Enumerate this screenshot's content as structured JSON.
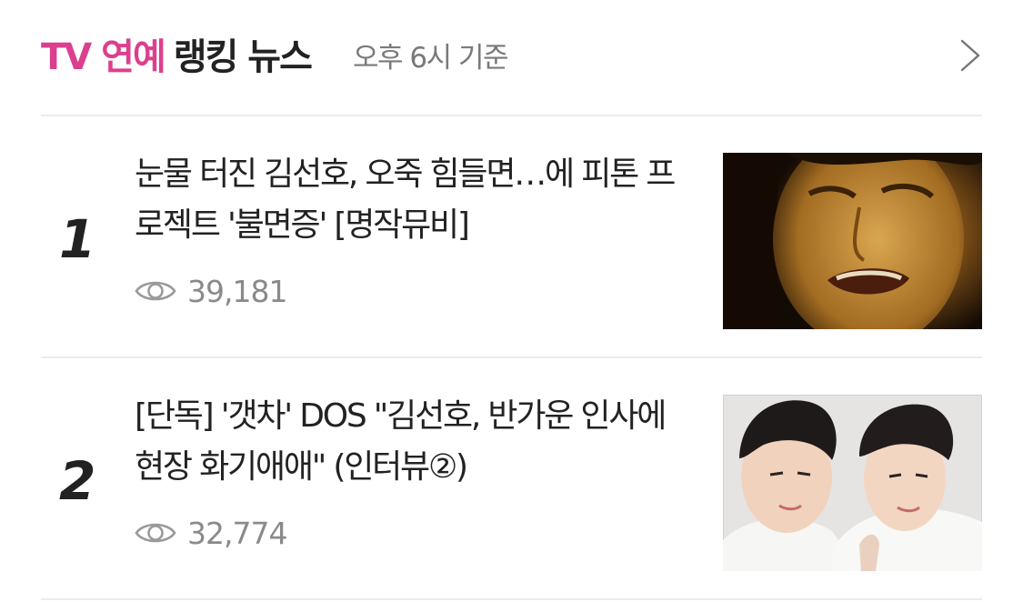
{
  "header": {
    "title_accent": "TV 연예",
    "title_main": "랭킹 뉴스",
    "subtitle": "오후 6시 기준",
    "more_icon": "chevron-right-icon"
  },
  "ranking": [
    {
      "rank": "1",
      "title": "눈물 터진 김선호, 오죽 힘들면…에 피톤 프로젝트 '불면증' [명작뮤비]",
      "views": "39,181",
      "view_icon": "eye-icon"
    },
    {
      "rank": "2",
      "title": "[단독] '갯차' DOS \"김선호, 반가운 인사에 현장 화기애애\" (인터뷰②)",
      "views": "32,774",
      "view_icon": "eye-icon"
    }
  ],
  "colors": {
    "accent": "#dc3f8e",
    "text": "#222222",
    "muted": "#8a8a8a",
    "divider": "#ececec"
  }
}
